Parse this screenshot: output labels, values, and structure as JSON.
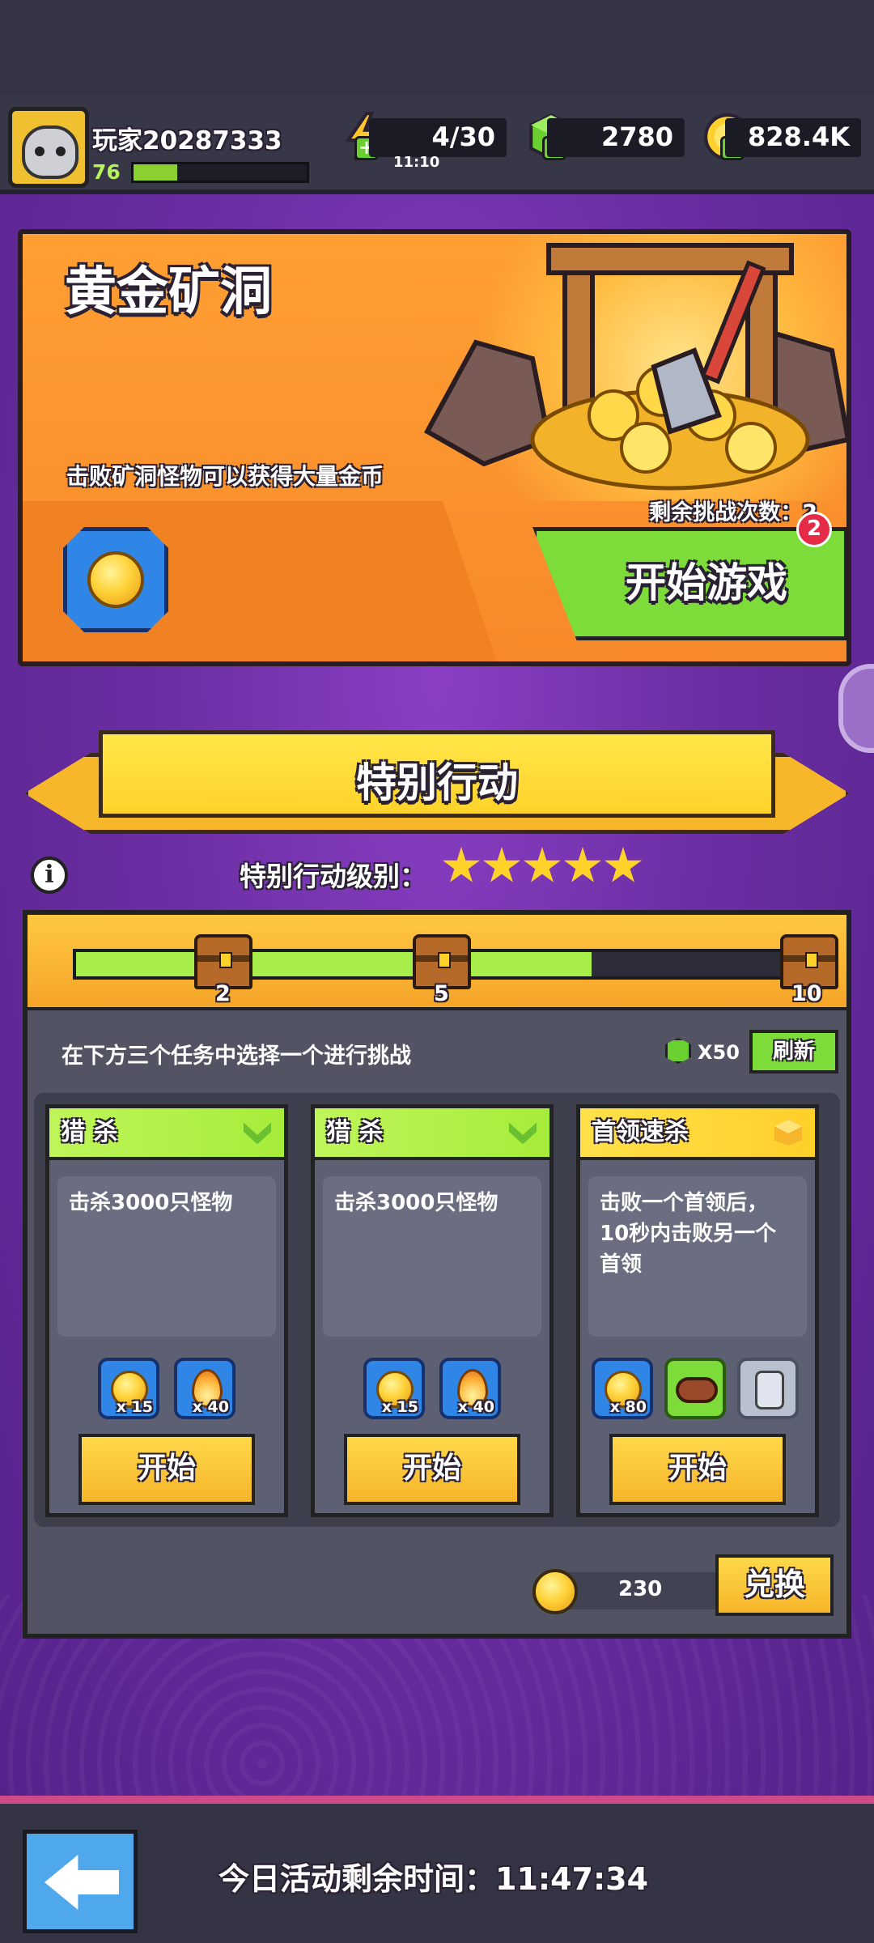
{
  "header": {
    "player_name": "玩家20287333",
    "level": "76",
    "xp_fraction": 0.25,
    "energy": "4/30",
    "energy_timer": "11:10",
    "gems": "2780",
    "gold": "828.4K"
  },
  "mine": {
    "title": "黄金矿洞",
    "description": "击败矿洞怪物可以获得大量金币",
    "remaining": "剩余挑战次数：2",
    "start_label": "开始游戏",
    "badge": "2"
  },
  "event": {
    "banner_title": "特别行动",
    "rank_label": "特别行动级别：",
    "stars": 5,
    "progress_fraction": 0.73,
    "milestones": [
      "2",
      "5",
      "10"
    ],
    "task_hint": "在下方三个任务中选择一个进行挑战",
    "refresh_cost": "X50",
    "refresh_label": "刷新",
    "tasks": [
      {
        "title": "猎 杀",
        "desc": "击杀3000只怪物",
        "rewards": [
          {
            "icon": "gold-coin-icon",
            "qty": "x 15"
          },
          {
            "icon": "flame-icon",
            "qty": "x 40"
          }
        ],
        "start_label": "开始"
      },
      {
        "title": "猎 杀",
        "desc": "击杀3000只怪物",
        "rewards": [
          {
            "icon": "gold-coin-icon",
            "qty": "x 15"
          },
          {
            "icon": "flame-icon",
            "qty": "x 40"
          }
        ],
        "start_label": "开始"
      },
      {
        "title": "首领速杀",
        "desc": "击败一个首领后，10秒内击败另一个首领",
        "rewards": [
          {
            "icon": "gold-coin-icon",
            "qty": "x 80"
          },
          {
            "icon": "collar-icon",
            "qty": ""
          },
          {
            "icon": "armor-icon",
            "qty": ""
          }
        ],
        "start_label": "开始"
      }
    ],
    "token_count": "230",
    "exchange_label": "兑换"
  },
  "footer": {
    "time_left": "今日活动剩余时间：11:47:34"
  },
  "colors": {
    "accent_green": "#7ddc3a",
    "accent_yellow": "#ffd22a",
    "panel_gray": "#525363",
    "purple": "#6b2ea3"
  }
}
